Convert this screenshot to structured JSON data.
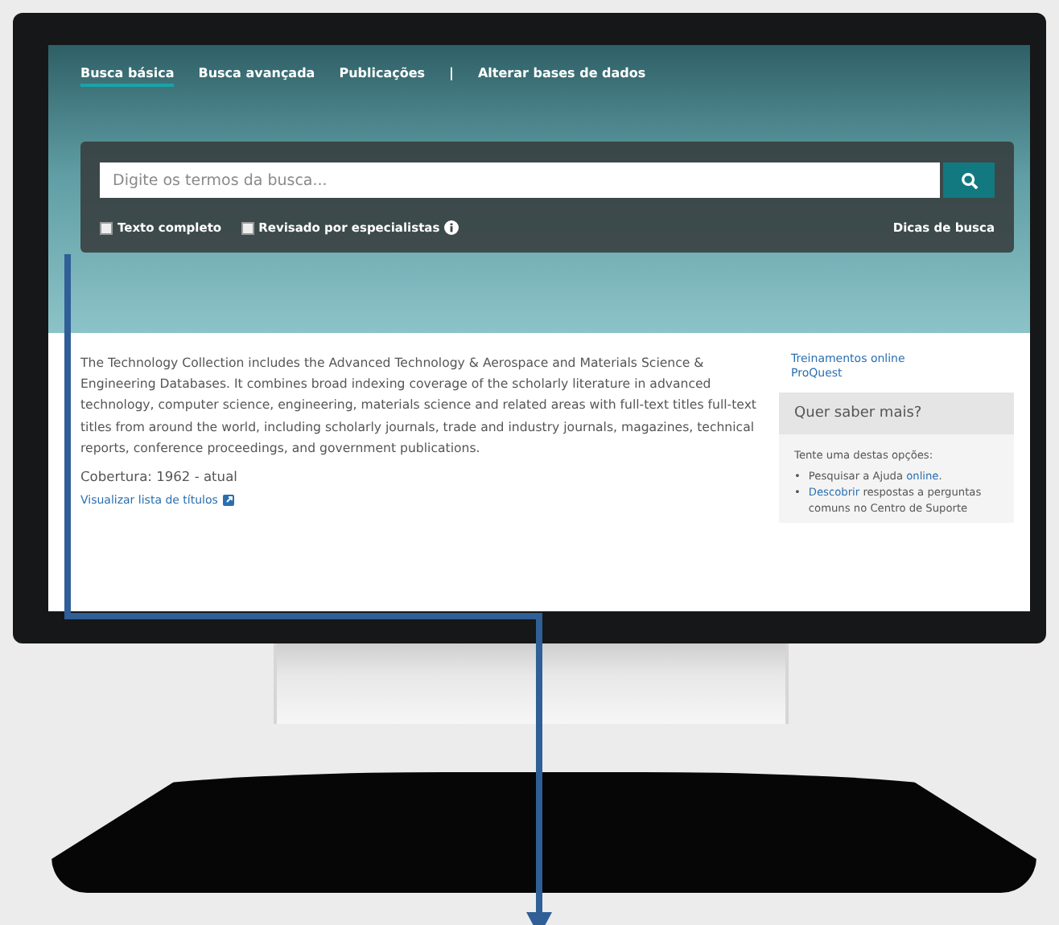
{
  "nav": {
    "tabs": [
      {
        "label": "Busca básica",
        "selected": true
      },
      {
        "label": "Busca avançada",
        "selected": false
      },
      {
        "label": "Publicações",
        "selected": false
      }
    ],
    "divider": "|",
    "link": "Alterar bases de dados"
  },
  "search": {
    "placeholder": "Digite os termos da busca..."
  },
  "filters": [
    {
      "label": "Texto completo",
      "checked": false
    },
    {
      "label": "Revisado por especialistas",
      "checked": false,
      "info": true
    }
  ],
  "tips_link": "Dicas de busca",
  "description": "The Technology Collection includes the Advanced Technology & Aerospace and Materials Science & Engineering Databases. It combines broad indexing coverage of the scholarly literature in advanced technology, computer science, engineering, materials science and related areas with full-text titles full-text titles from around the world, including scholarly journals, trade and industry journals, magazines, technical reports, conference proceedings, and government publications.",
  "coverage": "Cobertura: 1962 - atual",
  "titles_link": "Visualizar lista de títulos",
  "sidebar": {
    "training_link": "Treinamentos online ProQuest",
    "panel_title": "Quer saber mais?",
    "intro": "Tente uma destas opções:",
    "options": [
      {
        "bullet": "•",
        "before": "Pesquisar a Ajuda ",
        "link": "online",
        "after": "."
      },
      {
        "bullet": "•",
        "link": "Descobrir",
        "after": " respostas a perguntas comuns no Centro de Suporte"
      }
    ]
  }
}
